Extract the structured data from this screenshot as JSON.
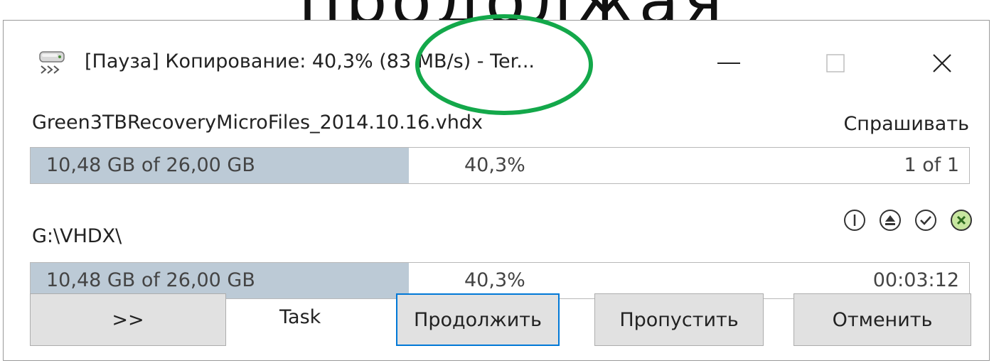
{
  "background_text": "продолжая",
  "window": {
    "title": "[Пауза] Копирование: 40,3%  (83 MB/s) - Ter...",
    "icons": {
      "app": "drive-copy-icon",
      "minimize": "minimize-icon",
      "maximize": "maximize-icon",
      "close": "close-icon"
    }
  },
  "current_file": {
    "name": "Green3TBRecoveryMicroFiles_2014.10.16.vhdx",
    "overwrite_mode": "Спрашивать",
    "progress": {
      "size_text": "10,48 GB of 26,00 GB",
      "percent_text": "40,3%",
      "fraction": 0.403,
      "count_text": "1 of 1"
    }
  },
  "destination": {
    "path": "G:\\VHDX\\",
    "icons": [
      "info-icon",
      "eject-icon",
      "check-icon",
      "cancel-circle-icon"
    ]
  },
  "total": {
    "progress": {
      "size_text": "10,48 GB of 26,00 GB",
      "percent_text": "40,3%",
      "fraction": 0.403,
      "time_text": "00:03:12"
    }
  },
  "buttons": {
    "more": ">>",
    "task": "Task",
    "continue": "Продолжить",
    "skip": "Пропустить",
    "cancel": "Отменить"
  },
  "colors": {
    "progress_fill": "#bccad6",
    "highlight_ring": "#13a84a",
    "focus_border": "#0078d7",
    "cancel_icon_fill": "#c8e6a0"
  }
}
